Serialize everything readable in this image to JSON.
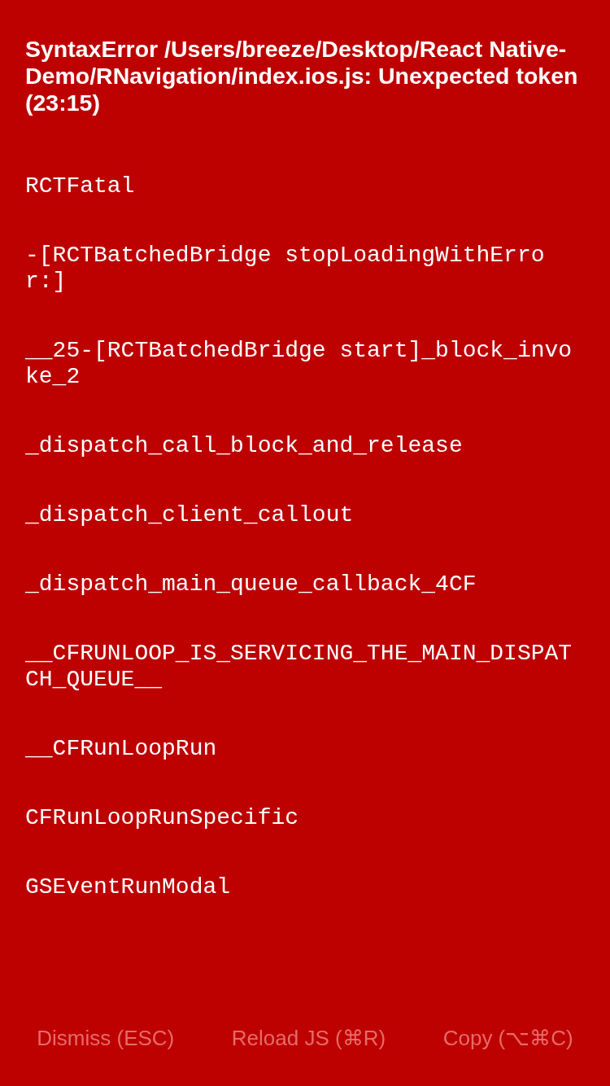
{
  "error": {
    "title": "SyntaxError /Users/breeze/Desktop/React Native-Demo/RNavigation/index.ios.js: Unexpected token (23:15)"
  },
  "stack": [
    "RCTFatal",
    "-[RCTBatchedBridge stopLoadingWithError:]",
    "__25-[RCTBatchedBridge start]_block_invoke_2",
    "_dispatch_call_block_and_release",
    "_dispatch_client_callout",
    "_dispatch_main_queue_callback_4CF",
    "__CFRUNLOOP_IS_SERVICING_THE_MAIN_DISPATCH_QUEUE__",
    "__CFRunLoopRun",
    "CFRunLoopRunSpecific",
    "GSEventRunModal"
  ],
  "buttons": [
    "Dismiss (ESC)",
    "Reload JS (⌘R)",
    "Copy (⌥⌘C)"
  ]
}
